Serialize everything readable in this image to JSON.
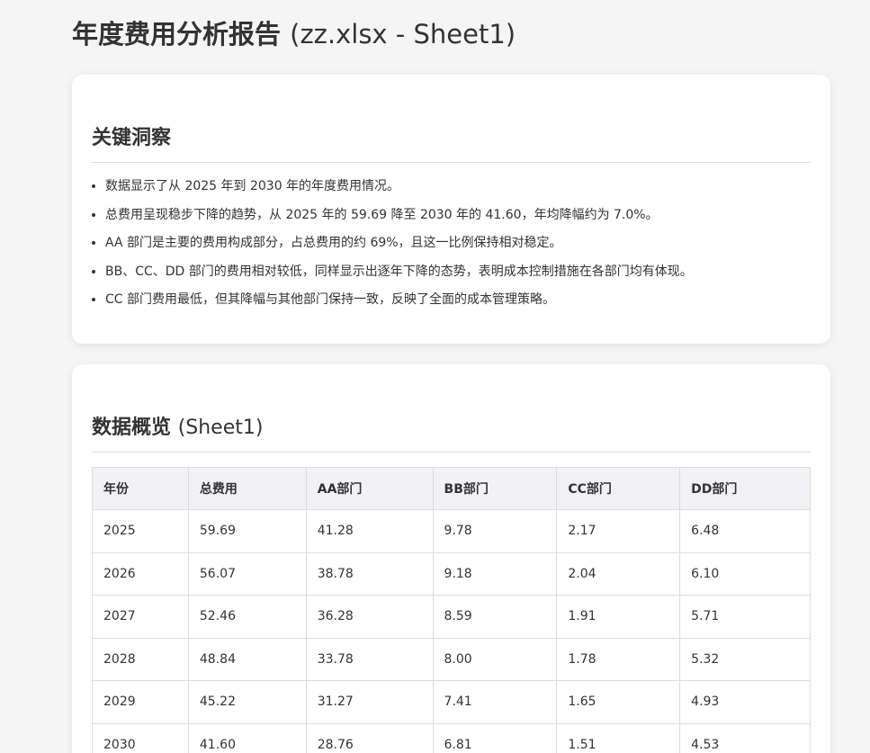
{
  "page": {
    "title_main": "年度费用分析报告",
    "title_suffix": "(zz.xlsx - Sheet1)"
  },
  "insights": {
    "title": "关键洞察",
    "items": [
      "数据显示了从 2025 年到 2030 年的年度费用情况。",
      "总费用呈现稳步下降的趋势，从 2025 年的 59.69 降至 2030 年的 41.60，年均降幅约为 7.0%。",
      "AA 部门是主要的费用构成部分，占总费用的约 69%，且这一比例保持相对稳定。",
      "BB、CC、DD 部门的费用相对较低，同样显示出逐年下降的态势，表明成本控制措施在各部门均有体现。",
      "CC 部门费用最低，但其降幅与其他部门保持一致，反映了全面的成本管理策略。"
    ]
  },
  "overview": {
    "title_main": "数据概览",
    "title_suffix": "(Sheet1)",
    "columns": [
      "年份",
      "总费用",
      "AA部门",
      "BB部门",
      "CC部门",
      "DD部门"
    ],
    "rows": [
      [
        "2025",
        "59.69",
        "41.28",
        "9.78",
        "2.17",
        "6.48"
      ],
      [
        "2026",
        "56.07",
        "38.78",
        "9.18",
        "2.04",
        "6.10"
      ],
      [
        "2027",
        "52.46",
        "36.28",
        "8.59",
        "1.91",
        "5.71"
      ],
      [
        "2028",
        "48.84",
        "33.78",
        "8.00",
        "1.78",
        "5.32"
      ],
      [
        "2029",
        "45.22",
        "31.27",
        "7.41",
        "1.65",
        "4.93"
      ],
      [
        "2030",
        "41.60",
        "28.76",
        "6.81",
        "1.51",
        "4.53"
      ]
    ]
  }
}
